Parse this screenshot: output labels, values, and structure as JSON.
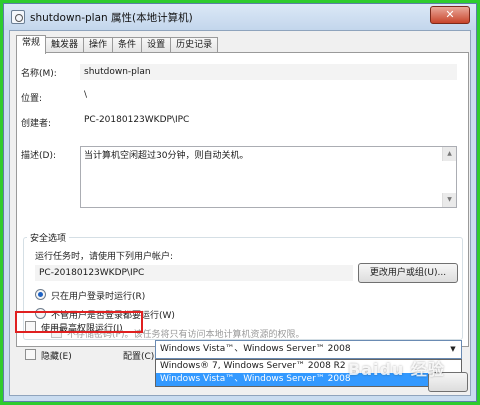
{
  "window": {
    "title": "shutdown-plan 属性(本地计算机)",
    "close_label": "✕"
  },
  "tabs": [
    {
      "label": "常规",
      "active": true
    },
    {
      "label": "触发器"
    },
    {
      "label": "操作"
    },
    {
      "label": "条件"
    },
    {
      "label": "设置"
    },
    {
      "label": "历史记录"
    }
  ],
  "general": {
    "name_label": "名称(M):",
    "name_value": "shutdown-plan",
    "location_label": "位置:",
    "location_value": "\\",
    "author_label": "创建者:",
    "author_value": "PC-20180123WKDP\\IPC",
    "description_label": "描述(D):",
    "description_value": "当计算机空闲超过30分钟，则自动关机。"
  },
  "security": {
    "group_title": "安全选项",
    "run_as_prompt": "运行任务时，请使用下列用户帐户:",
    "account_value": "PC-20180123WKDP\\IPC",
    "change_button": "更改用户或组(U)...",
    "radio_logged_on": "只在用户登录时运行(R)",
    "radio_logged_on_checked": true,
    "radio_whether": "不管用户是否登录都要运行(W)",
    "no_store_password": "不存储密码(P)。该任务将只有访问本地计算机资源的权限。",
    "highest_privileges": "使用最高权限运行(I)"
  },
  "bottom": {
    "hidden_label": "隐藏(E)",
    "config_label": "配置(C):",
    "config_selected": "Windows Vista™、Windows Server™ 2008",
    "config_options": [
      "Windows® 7, Windows Server™ 2008 R2",
      "Windows Vista™、Windows Server™ 2008"
    ]
  },
  "watermark": "Baidu 经验"
}
